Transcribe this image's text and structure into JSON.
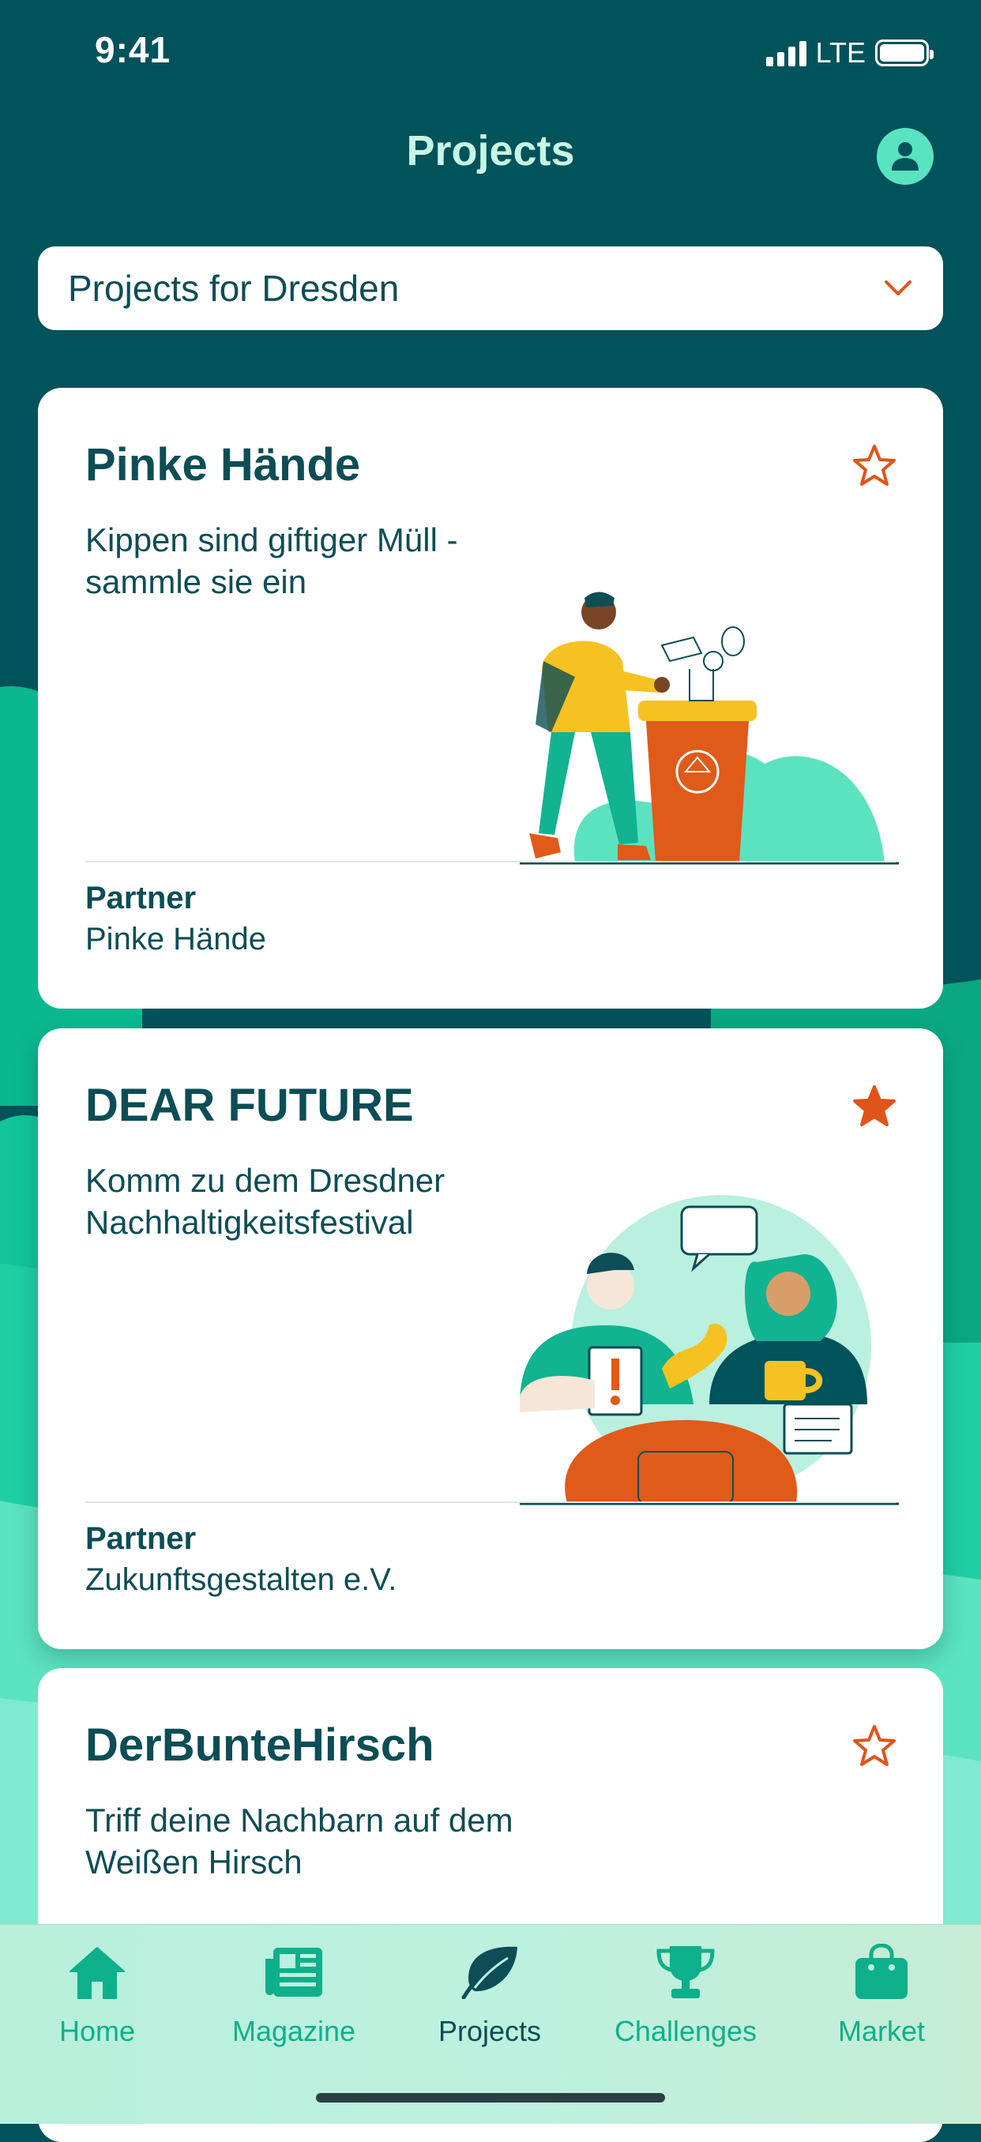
{
  "status_bar": {
    "time": "9:41",
    "network": "LTE",
    "icons": [
      "signal-icon",
      "battery-icon"
    ]
  },
  "header": {
    "title": "Projects",
    "profile_icon": "person-icon"
  },
  "city_selector": {
    "value": "Projects for Dresden",
    "icon": "chevron-down-icon"
  },
  "colors": {
    "background": "#00525b",
    "accent": "#5ae3c1",
    "title_text": "#0c4d56",
    "favorite": "#e0541a",
    "tab_active": "#0c4d56",
    "tab_inactive": "#0db08a"
  },
  "projects": [
    {
      "title": "Pinke Hände",
      "description": "Kippen sind giftiger Müll - sammle sie ein",
      "partner_label": "Partner",
      "partner_name": "Pinke Hände",
      "favorited": false
    },
    {
      "title": "DEAR FUTURE",
      "description": "Komm zu dem Dresdner Nachhaltigkeitsfestival",
      "partner_label": "Partner",
      "partner_name": "Zukunftsgestalten e.V.",
      "favorited": true
    },
    {
      "title": "DerBunteHirsch",
      "description": "Triff deine Nachbarn auf dem Weißen Hirsch",
      "favorited": false
    }
  ],
  "tab_bar": {
    "active": "Projects",
    "items": [
      {
        "label": "Home",
        "icon": "home-icon"
      },
      {
        "label": "Magazine",
        "icon": "newspaper-icon"
      },
      {
        "label": "Projects",
        "icon": "leaf-icon"
      },
      {
        "label": "Challenges",
        "icon": "trophy-icon"
      },
      {
        "label": "Market",
        "icon": "shopping-bag-icon"
      }
    ]
  }
}
